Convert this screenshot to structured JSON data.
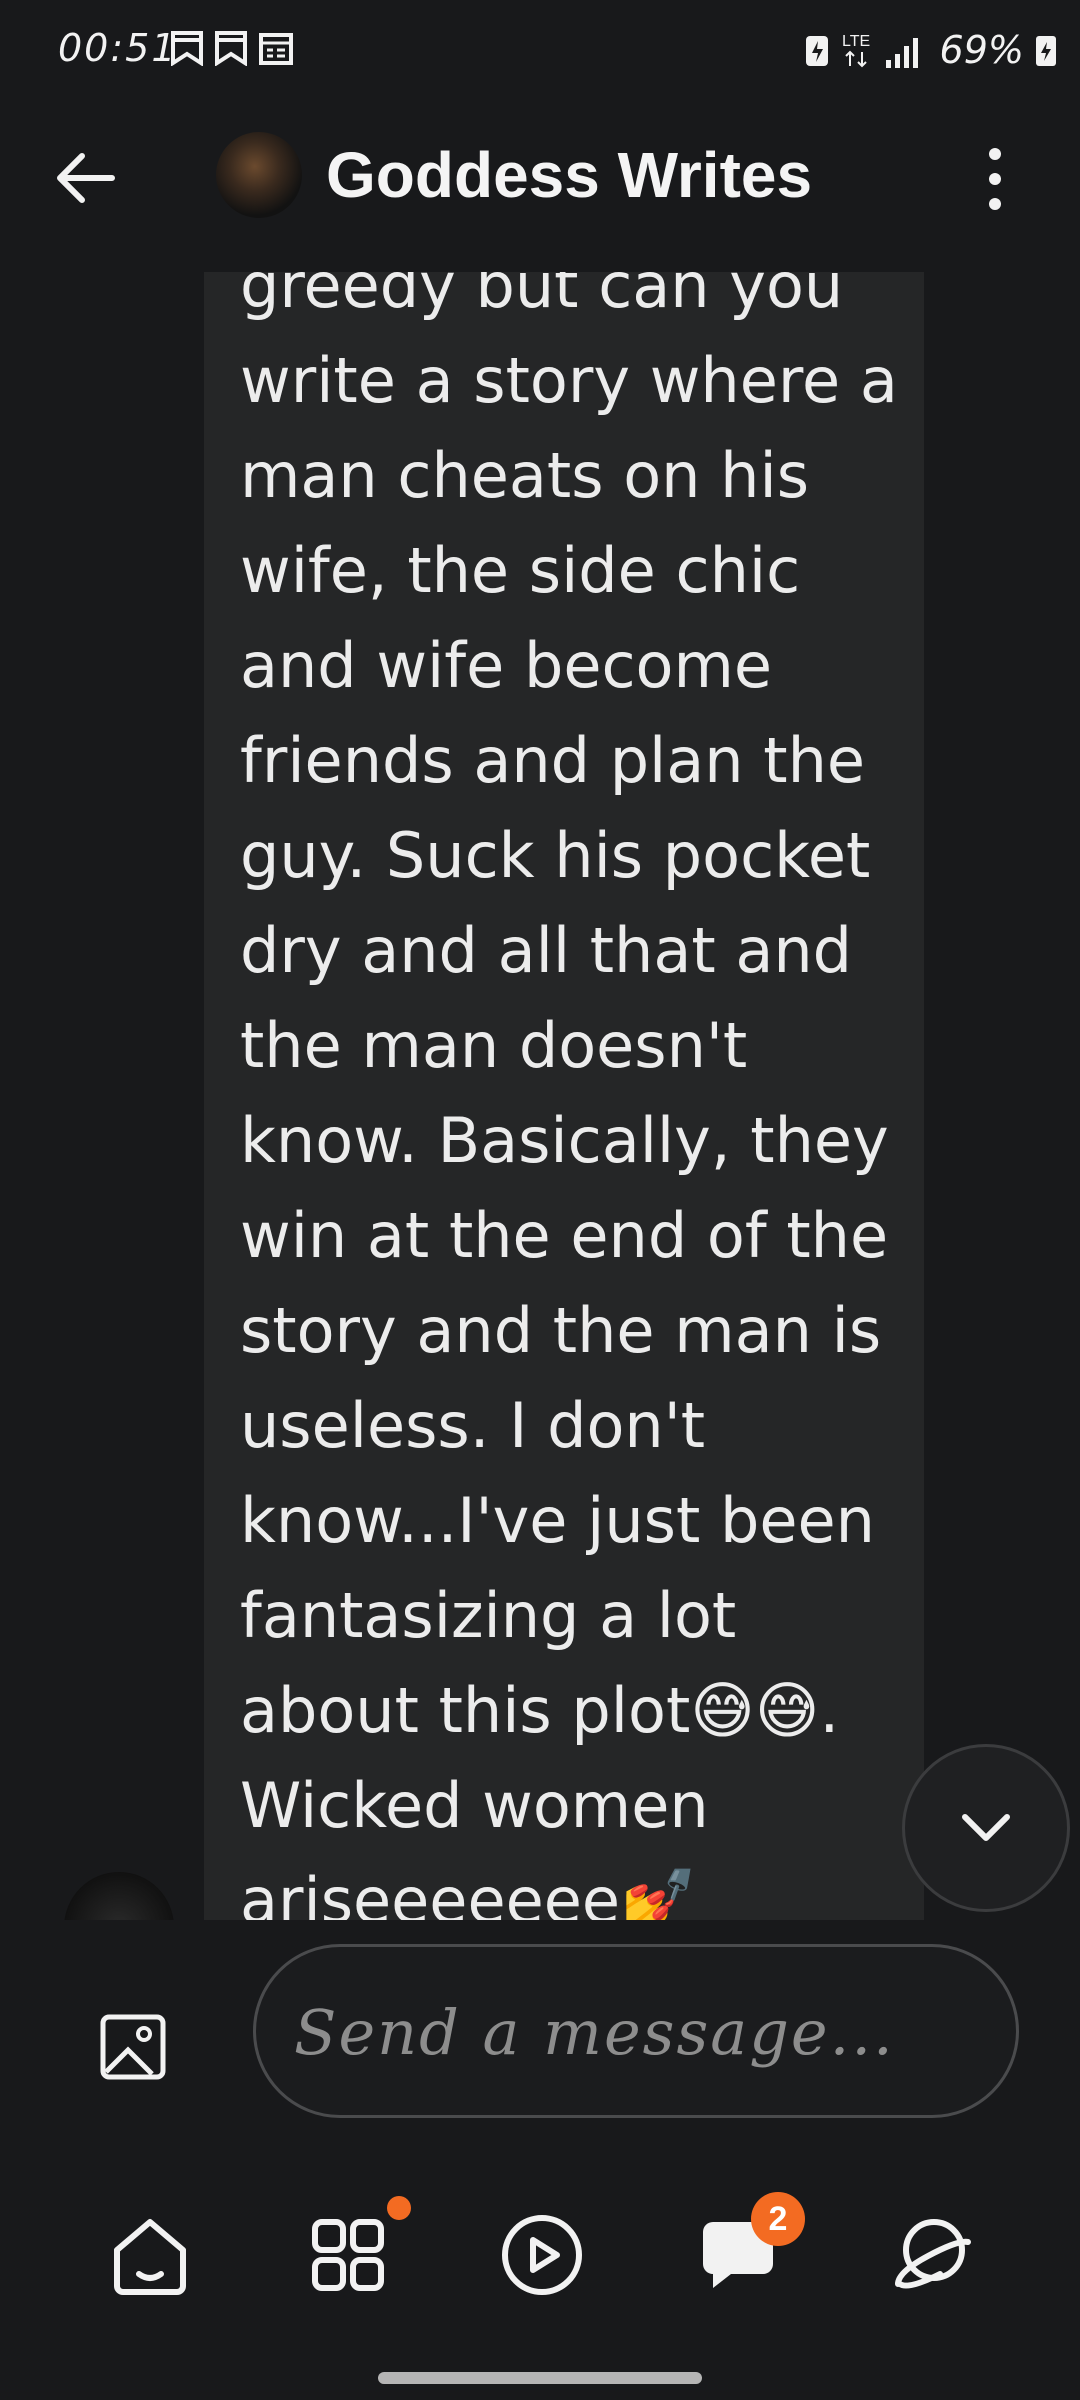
{
  "status_bar": {
    "time": "00:51",
    "network": "LTE",
    "battery": "69%"
  },
  "header": {
    "title": "Goddess Writes",
    "icons": [
      "back-arrow-icon",
      "more-vertical-icon"
    ]
  },
  "message": {
    "text": "greedy but can you write a story where a man cheats on his wife, the side chic and wife become friends and plan the guy. Suck his pocket dry and all that and the man doesn't know. Basically, they win at the end of the story and the man is useless. I don't know...I've just been fantasizing a lot about this plot😅😅. Wicked women ariseeeeeee💅"
  },
  "composer": {
    "placeholder": "Send a message..."
  },
  "bottom_nav": {
    "items": [
      "home",
      "apps",
      "play",
      "chat",
      "explore"
    ],
    "chat_badge": "2"
  },
  "colors": {
    "background": "#18191b",
    "bubble": "#252627",
    "accent": "#f36b22"
  }
}
